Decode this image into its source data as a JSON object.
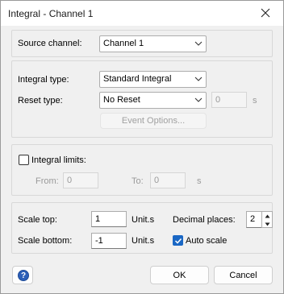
{
  "window": {
    "title": "Integral - Channel 1"
  },
  "source": {
    "label": "Source channel:",
    "value": "Channel 1"
  },
  "integral": {
    "type_label": "Integral type:",
    "type_value": "Standard Integral",
    "reset_label": "Reset type:",
    "reset_value": "No Reset",
    "reset_time_value": "0",
    "reset_time_unit": "s",
    "event_options_label": "Event Options..."
  },
  "limits": {
    "checkbox_label": "Integral limits:",
    "checked": false,
    "from_label": "From:",
    "from_value": "0",
    "to_label": "To:",
    "to_value": "0",
    "unit": "s"
  },
  "scale": {
    "top_label": "Scale top:",
    "top_value": "1",
    "top_unit": "Unit.s",
    "bottom_label": "Scale bottom:",
    "bottom_value": "-1",
    "bottom_unit": "Unit.s",
    "decimal_label": "Decimal places:",
    "decimal_value": "2",
    "auto_scale_label": "Auto scale",
    "auto_scale_checked": true
  },
  "buttons": {
    "help_icon": "question-circle",
    "ok": "OK",
    "cancel": "Cancel"
  },
  "colors": {
    "accent": "#1a67c4",
    "help": "#2c5fb8"
  }
}
